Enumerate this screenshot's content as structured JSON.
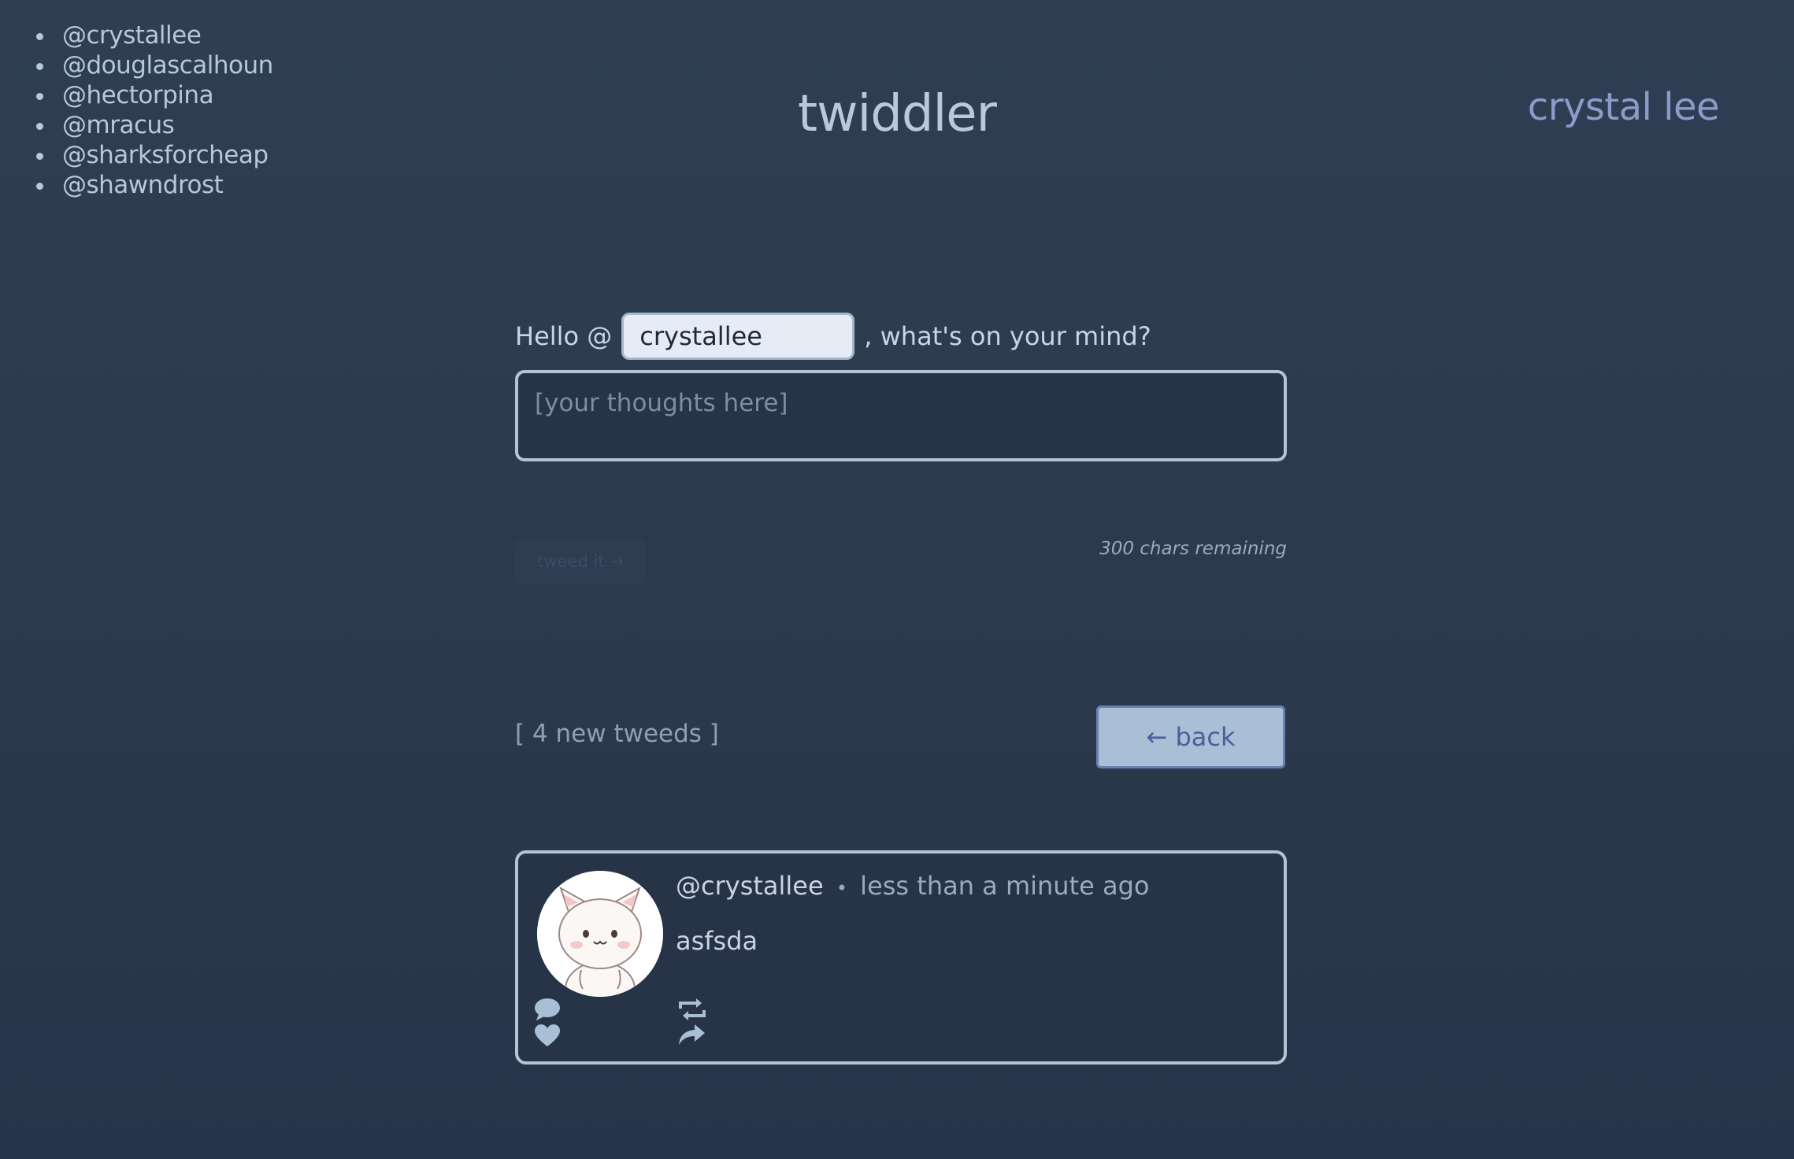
{
  "sidebar": {
    "users": [
      "@crystallee",
      "@douglascalhoun",
      "@hectorpina",
      "@mracus",
      "@sharksforcheap",
      "@shawndrost"
    ]
  },
  "header": {
    "title": "twiddler",
    "user_name": "crystal lee"
  },
  "compose": {
    "hello_prefix": "Hello @",
    "handle_value": "crystallee",
    "hello_suffix": ", what's on your mind?",
    "thoughts_placeholder": "[your thoughts here]",
    "submit_label": "tweed it →",
    "chars_remaining": "300 chars remaining"
  },
  "feed": {
    "new_tweeds": "[ 4 new tweeds ]",
    "back_label": "← back"
  },
  "tweets": [
    {
      "handle": "@crystallee",
      "separator": "•",
      "time": "less than a minute ago",
      "text": "asfsda"
    }
  ],
  "icons": {
    "comment": "comment-icon",
    "like": "heart-icon",
    "retweet": "retweet-icon",
    "share": "share-icon"
  },
  "colors": {
    "background": "#2f3e52",
    "accent": "#8d9bc9",
    "button_bg": "#a9bfd6",
    "card_border": "#b5c3d4"
  }
}
